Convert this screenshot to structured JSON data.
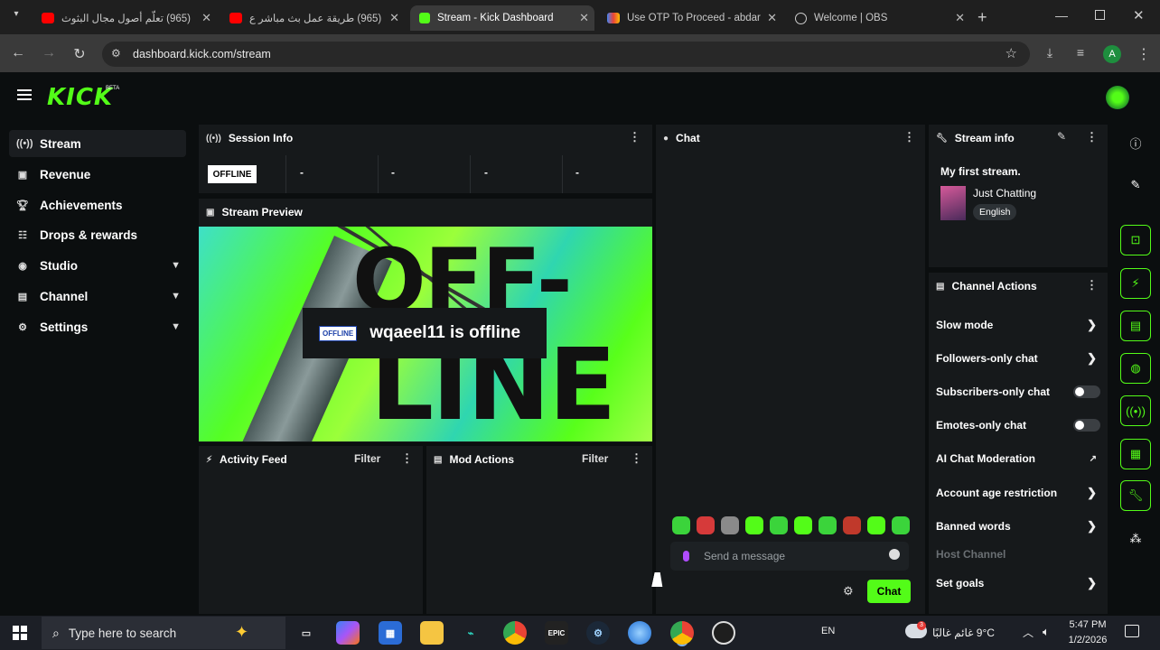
{
  "browser": {
    "tabs": [
      {
        "title": "(965) تعلّم أصول مجال البثوث",
        "favicon": "youtube-icon",
        "active": false
      },
      {
        "title": "(965) طريقة عمل بث مباشر ع",
        "favicon": "youtube-icon",
        "active": false
      },
      {
        "title": "Stream - Kick Dashboard",
        "favicon": "kick-icon",
        "active": true
      },
      {
        "title": "Use OTP To Proceed - abdar",
        "favicon": "gmail-icon",
        "active": false
      },
      {
        "title": "Welcome | OBS",
        "favicon": "globe-icon",
        "active": false
      }
    ],
    "url": "dashboard.kick.com/stream",
    "profile_initial": "A"
  },
  "kick": {
    "logo": "KICK",
    "beta": "BETA",
    "accent": "#53fc18"
  },
  "sidebar": {
    "items": [
      {
        "label": "Stream",
        "icon": "radio-wave-icon",
        "active": true,
        "expandable": false
      },
      {
        "label": "Revenue",
        "icon": "wallet-icon",
        "active": false,
        "expandable": false
      },
      {
        "label": "Achievements",
        "icon": "trophy-icon",
        "active": false,
        "expandable": false
      },
      {
        "label": "Drops & rewards",
        "icon": "gift-icon",
        "active": false,
        "expandable": false
      },
      {
        "label": "Studio",
        "icon": "studio-icon",
        "active": false,
        "expandable": true
      },
      {
        "label": "Channel",
        "icon": "channel-icon",
        "active": false,
        "expandable": true
      },
      {
        "label": "Settings",
        "icon": "gear-icon",
        "active": false,
        "expandable": true
      }
    ]
  },
  "session_info": {
    "title": "Session Info",
    "status_badge": "OFFLINE",
    "stats": [
      "-",
      "-",
      "-",
      "-"
    ]
  },
  "stream_preview": {
    "title": "Stream Preview",
    "overlay_badge": "OFFLINE",
    "overlay_text": "wqaeel11 is offline",
    "background_text_top": "OFF-",
    "background_text_bottom": "LINE"
  },
  "activity_feed": {
    "title": "Activity Feed",
    "filter": "Filter"
  },
  "mod_actions": {
    "title": "Mod Actions",
    "filter": "Filter"
  },
  "chat": {
    "title": "Chat",
    "placeholder": "Send a message",
    "send_label": "Chat",
    "emote_count": 10
  },
  "stream_info": {
    "title": "Stream info",
    "stream_title": "My first stream.",
    "category": "Just Chatting",
    "language": "English"
  },
  "channel_actions": {
    "title": "Channel Actions",
    "items": [
      {
        "label": "Slow mode",
        "control": "chevron"
      },
      {
        "label": "Followers-only chat",
        "control": "chevron"
      },
      {
        "label": "Subscribers-only chat",
        "control": "toggle"
      },
      {
        "label": "Emotes-only chat",
        "control": "toggle"
      },
      {
        "label": "AI Chat Moderation",
        "control": "external"
      },
      {
        "label": "Account age restriction",
        "control": "chevron"
      },
      {
        "label": "Banned words",
        "control": "chevron"
      },
      {
        "label": "Host Channel",
        "control": "none",
        "disabled": true
      },
      {
        "label": "Set goals",
        "control": "chevron"
      }
    ]
  },
  "taskbar": {
    "search_placeholder": "Type here to search",
    "language": "EN",
    "weather": "9°C  غائم غالبًا",
    "time": "5:47 PM",
    "date": "1/2/2026",
    "notification_count": "3"
  }
}
